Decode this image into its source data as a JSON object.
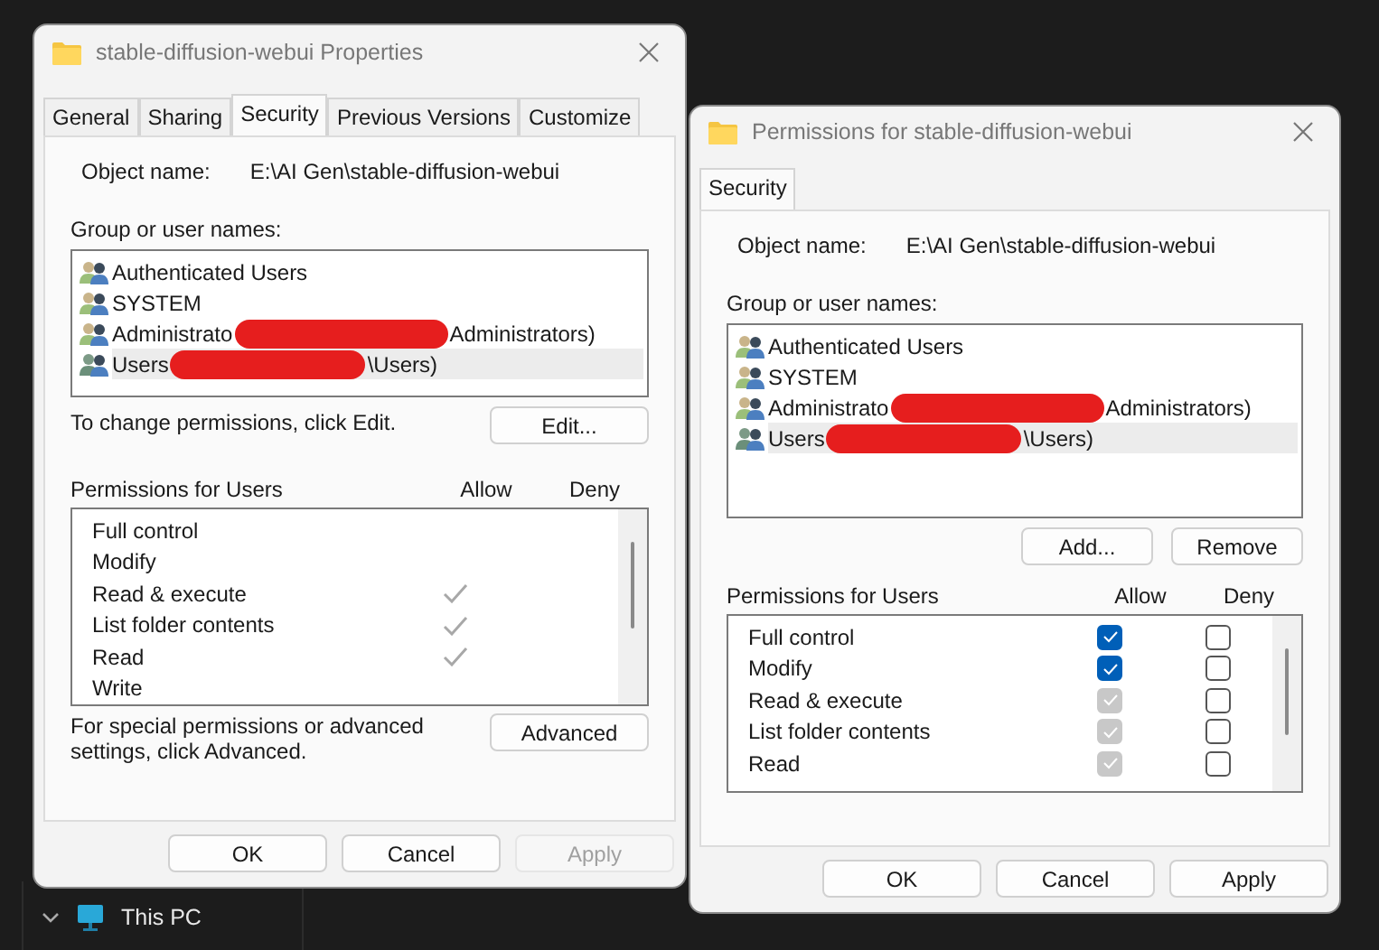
{
  "windows": [
    {
      "kind": "view",
      "title": "stable-diffusion-webui Properties",
      "tabs": [
        {
          "label": "General",
          "selected": false
        },
        {
          "label": "Sharing",
          "selected": false
        },
        {
          "label": "Security",
          "selected": true
        },
        {
          "label": "Previous Versions",
          "selected": false
        },
        {
          "label": "Customize",
          "selected": false
        }
      ],
      "object_label": "Object name:",
      "object_name": "E:\\AI Gen\\stable-diffusion-webui",
      "group_label": "Group or user names:",
      "users": [
        {
          "name": "Authenticated Users",
          "redacted": false,
          "selected": false
        },
        {
          "name": "SYSTEM",
          "redacted": false,
          "selected": false
        },
        {
          "name": "Administrato",
          "suffix": "Administrators)",
          "redacted": true,
          "selected": false
        },
        {
          "name": "Users",
          "suffix": "\\Users)",
          "redacted": true,
          "selected": true
        }
      ],
      "change_note": "To change permissions, click Edit.",
      "list_buttons": [
        "Edit..."
      ],
      "perm_label": "Permissions for Users",
      "allow_label": "Allow",
      "deny_label": "Deny",
      "permissions": [
        {
          "label": "Full control",
          "allow": false,
          "deny": false
        },
        {
          "label": "Modify",
          "allow": false,
          "deny": false
        },
        {
          "label": "Read & execute",
          "allow": true,
          "deny": false
        },
        {
          "label": "List folder contents",
          "allow": true,
          "deny": false
        },
        {
          "label": "Read",
          "allow": true,
          "deny": false
        },
        {
          "label": "Write",
          "allow": false,
          "deny": false
        }
      ],
      "advanced_note": "For special permissions or advanced settings, click Advanced.",
      "advanced_button": "Advanced",
      "buttons": [
        {
          "label": "OK",
          "disabled": false
        },
        {
          "label": "Cancel",
          "disabled": false
        },
        {
          "label": "Apply",
          "disabled": true
        }
      ]
    },
    {
      "kind": "edit",
      "title": "Permissions for stable-diffusion-webui",
      "tabs": [
        {
          "label": "Security",
          "selected": true
        }
      ],
      "object_label": "Object name:",
      "object_name": "E:\\AI Gen\\stable-diffusion-webui",
      "group_label": "Group or user names:",
      "users": [
        {
          "name": "Authenticated Users",
          "redacted": false,
          "selected": false
        },
        {
          "name": "SYSTEM",
          "redacted": false,
          "selected": false
        },
        {
          "name": "Administrato",
          "suffix": "Administrators)",
          "redacted": true,
          "selected": false
        },
        {
          "name": "Users",
          "suffix": "\\Users)",
          "redacted": true,
          "selected": true
        }
      ],
      "list_buttons": [
        "Add...",
        "Remove"
      ],
      "perm_label": "Permissions for Users",
      "allow_label": "Allow",
      "deny_label": "Deny",
      "permissions": [
        {
          "label": "Full control",
          "allow": true,
          "deny": false,
          "inherited": false
        },
        {
          "label": "Modify",
          "allow": true,
          "deny": false,
          "inherited": false
        },
        {
          "label": "Read & execute",
          "allow": true,
          "deny": false,
          "inherited": true
        },
        {
          "label": "List folder contents",
          "allow": true,
          "deny": false,
          "inherited": true
        },
        {
          "label": "Read",
          "allow": true,
          "deny": false,
          "inherited": true
        }
      ],
      "buttons": [
        {
          "label": "OK",
          "disabled": false
        },
        {
          "label": "Cancel",
          "disabled": false
        },
        {
          "label": "Apply",
          "disabled": false
        }
      ]
    }
  ],
  "explorer": {
    "items": [
      {
        "label": "This PC",
        "expanded": true
      }
    ]
  }
}
